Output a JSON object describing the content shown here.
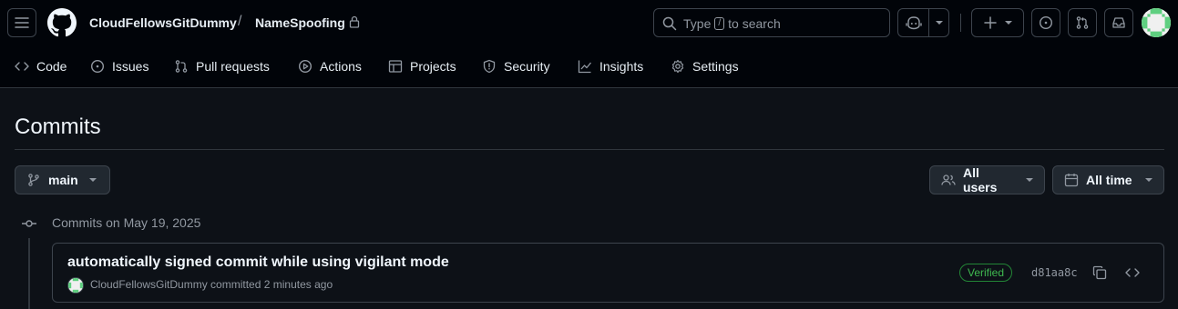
{
  "header": {
    "owner": "CloudFellowsGitDummy",
    "separator": "/",
    "repo": "NameSpoofing",
    "search": {
      "prefix": "Type",
      "key": "/",
      "suffix": "to search"
    }
  },
  "nav": [
    {
      "label": "Code",
      "icon": "code-icon"
    },
    {
      "label": "Issues",
      "icon": "issue-icon"
    },
    {
      "label": "Pull requests",
      "icon": "pull-request-icon"
    },
    {
      "label": "Actions",
      "icon": "play-icon"
    },
    {
      "label": "Projects",
      "icon": "table-icon"
    },
    {
      "label": "Security",
      "icon": "shield-icon"
    },
    {
      "label": "Insights",
      "icon": "graph-icon"
    },
    {
      "label": "Settings",
      "icon": "gear-icon"
    }
  ],
  "page": {
    "title": "Commits",
    "branch": "main",
    "users_filter": "All users",
    "time_filter": "All time"
  },
  "commit_groups": [
    {
      "heading": "Commits on May 19, 2025",
      "commits": [
        {
          "message": "automatically signed commit while using vigilant mode",
          "author": "CloudFellowsGitDummy",
          "action": "committed",
          "time": "2 minutes ago",
          "badge": "Verified",
          "sha": "d81aa8c"
        }
      ]
    }
  ],
  "colors": {
    "background": "#0d1117",
    "header_bg": "#010409",
    "border": "#3d444d",
    "verified_green": "#3fb950"
  }
}
